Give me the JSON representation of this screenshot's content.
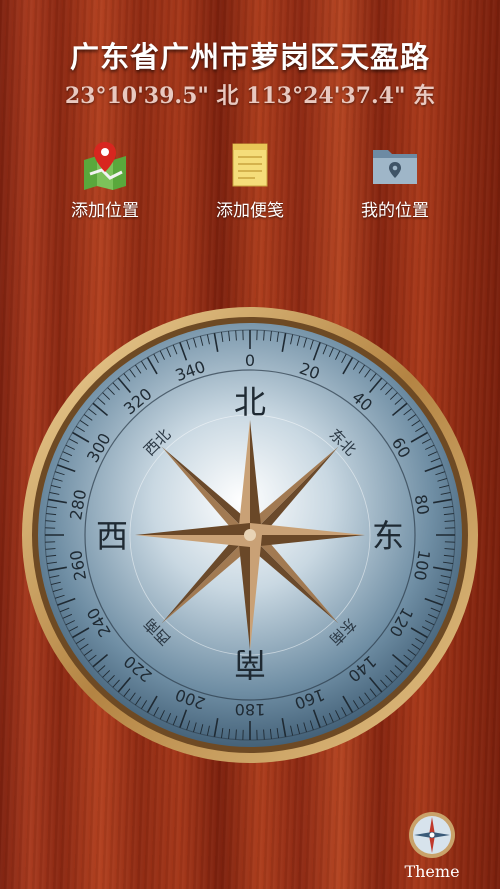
{
  "header": {
    "address": "广东省广州市萝岗区天盈路",
    "coordinates": "23°10'39.5\" 北 113°24'37.4\" 东"
  },
  "actions": [
    {
      "label": "添加位置",
      "icon": "map-pin-icon"
    },
    {
      "label": "添加便笺",
      "icon": "note-icon"
    },
    {
      "label": "我的位置",
      "icon": "folder-location-icon"
    }
  ],
  "compass": {
    "cardinals": {
      "north": "北",
      "east": "东",
      "south": "南",
      "west": "西"
    },
    "intercardinals": {
      "northeast": "东北",
      "southeast": "东南",
      "southwest": "西南",
      "northwest": "西北"
    },
    "degree_labels": [
      "0",
      "20",
      "40",
      "60",
      "80",
      "100",
      "120",
      "140",
      "160",
      "180",
      "200",
      "220",
      "240",
      "260",
      "280",
      "300",
      "320",
      "340"
    ]
  },
  "theme": {
    "label": "Theme",
    "icon": "compass-icon"
  },
  "colors": {
    "text": "#ffffff",
    "coords": "#e9c9c0",
    "rim": "#c89a55",
    "dial": "#7f9cb0"
  }
}
